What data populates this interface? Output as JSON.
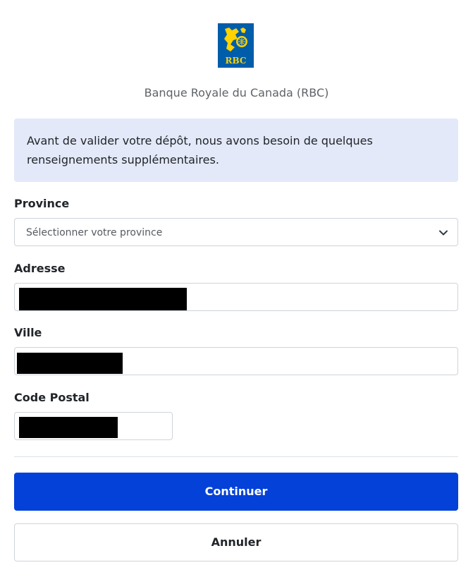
{
  "brand": {
    "logo_text": "RBC",
    "name": "Banque Royale du Canada (RBC)",
    "colors": {
      "blue": "#005DAA",
      "gold": "#FFD200",
      "button": "#0441d8",
      "info_bg": "#e3e9f9"
    }
  },
  "notice": {
    "text": "Avant de valider votre dépôt, nous avons besoin de quelques renseignements supplémentaires."
  },
  "form": {
    "province": {
      "label": "Province",
      "selected": "Sélectionner votre province"
    },
    "address": {
      "label": "Adresse",
      "value": "[redacted]"
    },
    "city": {
      "label": "Ville",
      "value": "[redacted]"
    },
    "postal_code": {
      "label": "Code Postal",
      "value": "[redacted]"
    }
  },
  "actions": {
    "continue_label": "Continuer",
    "cancel_label": "Annuler"
  },
  "icons": [
    "rbc-logo-icon",
    "chevron-down-icon"
  ]
}
